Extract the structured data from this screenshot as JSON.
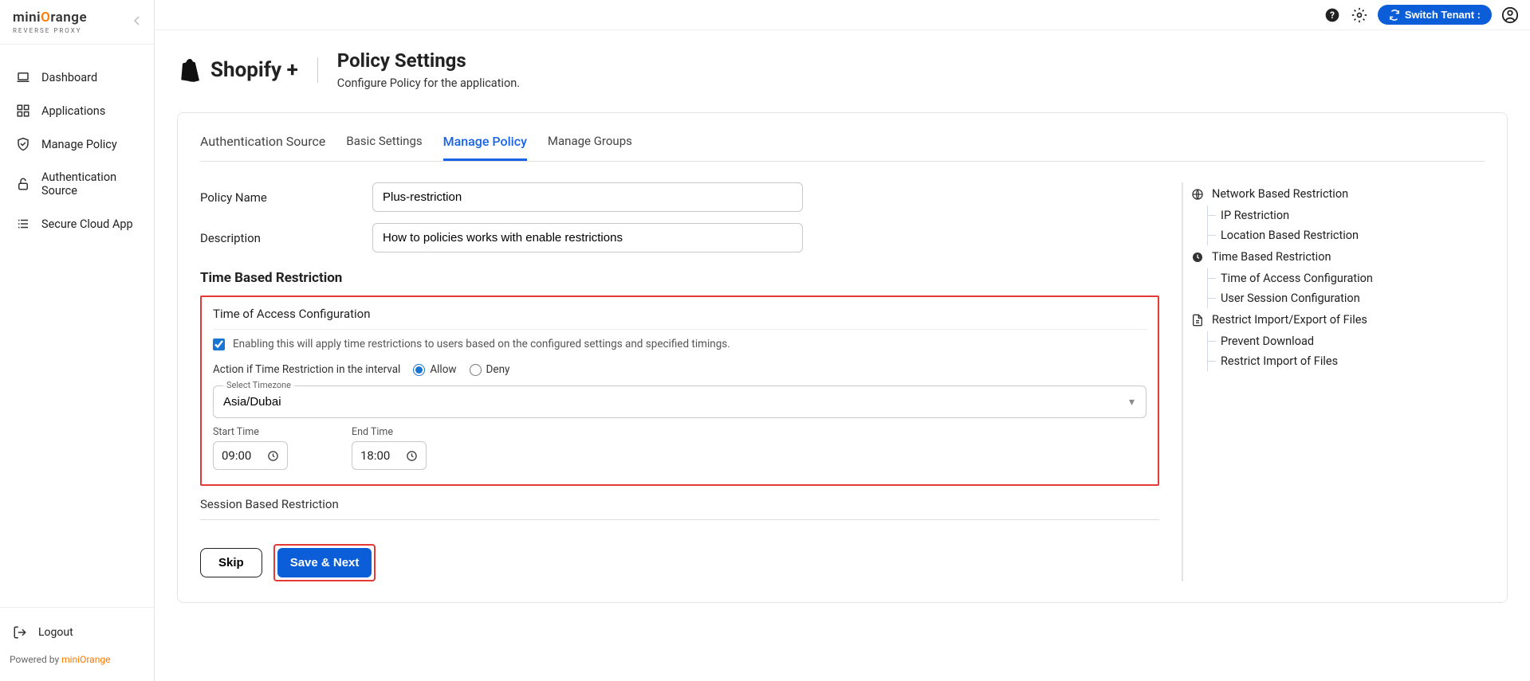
{
  "brand": {
    "name_pre": "mini",
    "name_highlight": "O",
    "name_post": "range",
    "subtitle": "REVERSE PROXY"
  },
  "sidebar": {
    "items": [
      {
        "label": "Dashboard"
      },
      {
        "label": "Applications"
      },
      {
        "label": "Manage Policy"
      },
      {
        "label": "Authentication Source"
      },
      {
        "label": "Secure Cloud App"
      }
    ],
    "logout": "Logout",
    "powered_prefix": "Powered by ",
    "powered_link": "miniOrange"
  },
  "topbar": {
    "switch_tenant": "Switch Tenant :"
  },
  "header": {
    "app_name": "Shopify +",
    "title": "Policy Settings",
    "subtitle": "Configure Policy for the application."
  },
  "tabs": [
    {
      "label": "Authentication Source"
    },
    {
      "label": "Basic Settings"
    },
    {
      "label": "Manage Policy"
    },
    {
      "label": "Manage Groups"
    }
  ],
  "form": {
    "policy_name_label": "Policy Name",
    "policy_name_value": "Plus-restriction",
    "description_label": "Description",
    "description_value": "How to policies works with enable restrictions"
  },
  "time_section": {
    "title": "Time Based Restriction",
    "box_heading": "Time of Access Configuration",
    "checkbox_text": "Enabling this will apply time restrictions to users based on the configured settings and specified timings.",
    "action_label": "Action if Time Restriction in the interval",
    "allow": "Allow",
    "deny": "Deny",
    "tz_label": "Select Timezone",
    "tz_value": "Asia/Dubai",
    "start_label": "Start Time",
    "start_value": "09:00",
    "end_label": "End Time",
    "end_value": "18:00",
    "session_title": "Session Based Restriction"
  },
  "actions": {
    "skip": "Skip",
    "save": "Save & Next"
  },
  "tree": {
    "network": "Network Based Restriction",
    "ip": "IP Restriction",
    "location": "Location Based Restriction",
    "time": "Time Based Restriction",
    "time_access": "Time of Access Configuration",
    "user_session": "User Session Configuration",
    "restrict_files": "Restrict Import/Export of Files",
    "prevent_download": "Prevent Download",
    "restrict_import": "Restrict Import of Files"
  }
}
